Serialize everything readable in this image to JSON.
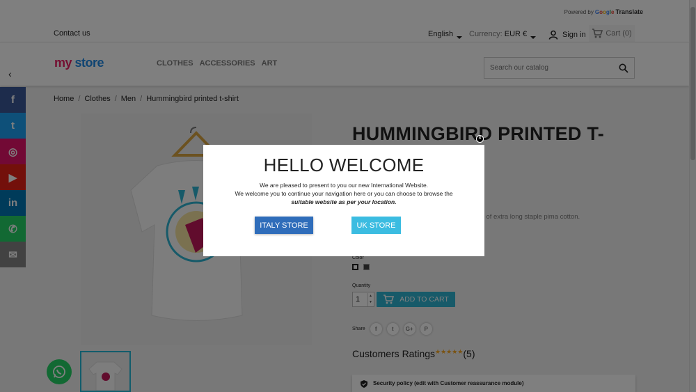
{
  "header": {
    "powered_by": "Powered by",
    "google": [
      "G",
      "o",
      "o",
      "g",
      "l",
      "e"
    ],
    "translate": "Translate",
    "contact": "Contact us",
    "language": "English",
    "currency_label": "Currency:",
    "currency_value": "EUR €",
    "sign_in": "Sign in",
    "cart": "Cart (0)"
  },
  "nav": {
    "logo_my": "my",
    "logo_store": "store",
    "menu": [
      "CLOTHES",
      "ACCESSORIES",
      "ART"
    ],
    "search_placeholder": "Search our catalog"
  },
  "social": [
    {
      "name": "facebook",
      "glyph": "f",
      "color": "#3b5998"
    },
    {
      "name": "twitter",
      "glyph": "t",
      "color": "#1da1f2"
    },
    {
      "name": "instagram",
      "glyph": "◎",
      "color": "#e4126b"
    },
    {
      "name": "youtube",
      "glyph": "▶",
      "color": "#e62117"
    },
    {
      "name": "linkedin",
      "glyph": "in",
      "color": "#0077b5"
    },
    {
      "name": "whatsapp",
      "glyph": "✆",
      "color": "#25d366"
    },
    {
      "name": "email",
      "glyph": "✉",
      "color": "#848484"
    }
  ],
  "breadcrumb": [
    "Home",
    "Clothes",
    "Men",
    "Hummingbird printed t-shirt"
  ],
  "product": {
    "title": "HUMMINGBIRD PRINTED T-",
    "desc_fragment": "ade of extra long staple pima cotton.",
    "color_label": "Color",
    "quantity_label": "Quantity",
    "quantity": "1",
    "add_to_cart": "ADD TO CART",
    "share_label": "Share",
    "share_buttons": [
      "f",
      "t",
      "G+",
      "P"
    ],
    "ratings_label": "Customers Ratings",
    "stars": "★★★★★",
    "ratings_count": "(5)",
    "security": "Security policy (edit with Customer reassurance module)"
  },
  "modal": {
    "title": "HELLO WELCOME",
    "line1": "We are pleased to present to you our new International Website.",
    "line2": "We welcome you to continue your navigation here or you can choose to browse the",
    "line3": "suitable website as per your location.",
    "italy_button": "ITALY STORE",
    "uk_button": "UK STORE",
    "close": "×"
  },
  "colors": {
    "accent": "#2fb5d2",
    "italy": "#2f6dba",
    "uk": "#3bbce1"
  }
}
